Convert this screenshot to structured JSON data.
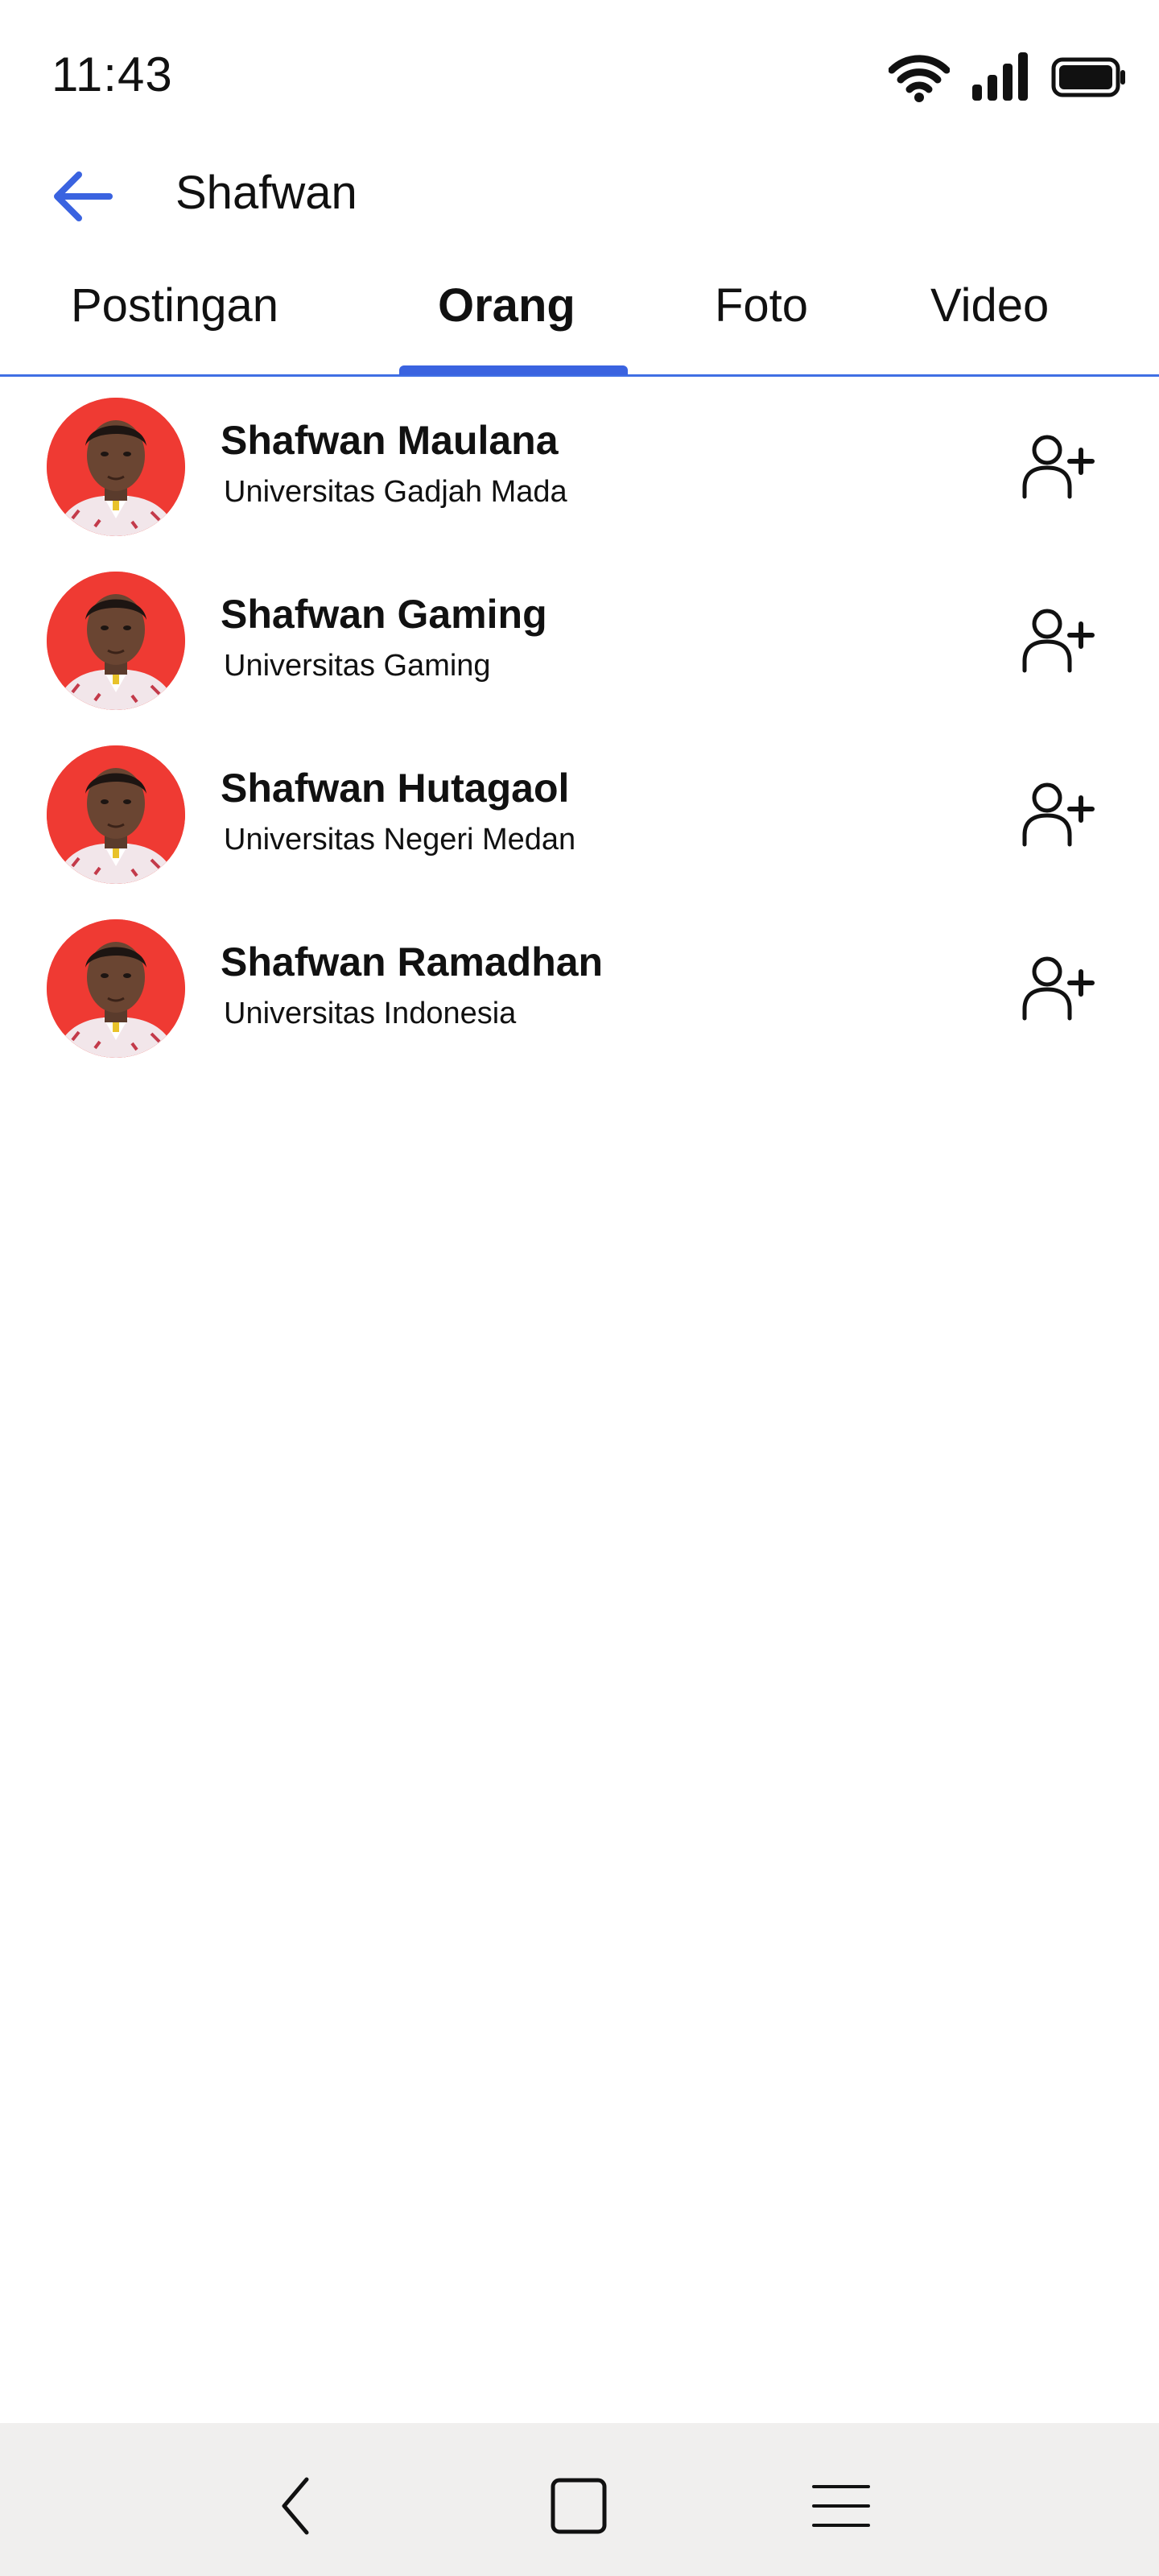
{
  "status_bar": {
    "time": "11:43",
    "icons": [
      "wifi-icon",
      "signal-icon",
      "battery-icon"
    ]
  },
  "header": {
    "title": "Shafwan",
    "back_icon": "arrow-left-icon"
  },
  "tabs": [
    {
      "label": "Postingan",
      "active": false
    },
    {
      "label": "Orang",
      "active": true
    },
    {
      "label": "Foto",
      "active": false
    },
    {
      "label": "Video",
      "active": false
    }
  ],
  "people": [
    {
      "name": "Shafwan Maulana",
      "subtitle": "Universitas Gadjah Mada"
    },
    {
      "name": "Shafwan Gaming",
      "subtitle": "Universitas Gaming"
    },
    {
      "name": "Shafwan Hutagaol",
      "subtitle": "Universitas Negeri Medan"
    },
    {
      "name": "Shafwan Ramadhan",
      "subtitle": "Universitas Indonesia"
    }
  ],
  "nav_bar": {
    "icons": [
      "nav-back-icon",
      "nav-home-icon",
      "nav-menu-icon"
    ]
  },
  "colors": {
    "accent": "#3a63e0",
    "avatar_bg": "#ef3a33",
    "nav_bg": "#f0efee"
  }
}
